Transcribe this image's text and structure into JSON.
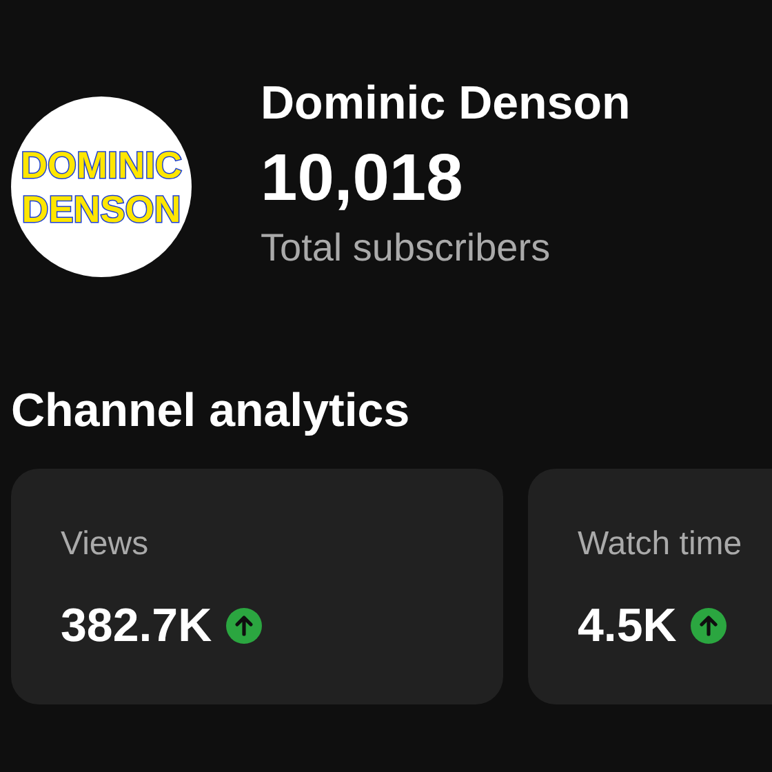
{
  "channel": {
    "avatar_text": [
      "DOMINIC",
      "DENSON"
    ],
    "name": "Dominic Denson",
    "subscriber_count": "10,018",
    "subscriber_label": "Total subscribers"
  },
  "section_title": "Channel analytics",
  "cards": [
    {
      "label": "Views",
      "value": "382.7K",
      "rising": true
    },
    {
      "label": "Watch time",
      "value": "4.5K",
      "rising": true
    }
  ]
}
